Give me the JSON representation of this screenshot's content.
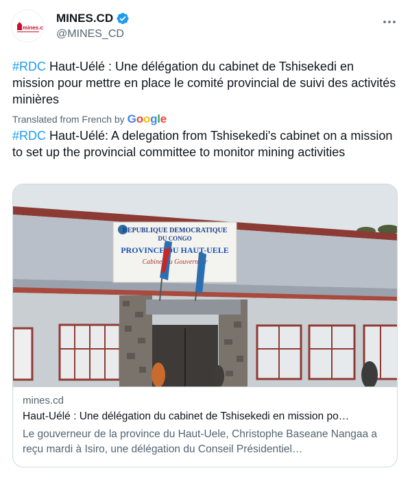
{
  "account": {
    "display_name": "MINES.CD",
    "handle": "@MINES_CD",
    "avatar_logo_text": "mines.cd",
    "verified": true
  },
  "tweet": {
    "original": {
      "hashtag": "#RDC",
      "text": " Haut-Uélé : Une délégation du cabinet de Tshisekedi en mission pour mettre en place le comité provincial de suivi des activités minières"
    },
    "translation_label": "Translated from French by",
    "translation_provider": "Google",
    "translated": {
      "hashtag": "#RDC",
      "text": " Haut-Uélé: A delegation from Tshisekedi's cabinet on a mission to set up the provincial committee to monitor mining activities"
    }
  },
  "link_card": {
    "image_sign_lines": [
      "REPUBLIQUE DEMOCRATIQUE",
      "DU CONGO",
      "PROVINCE DU HAUT-UELE",
      "Cabinet du Gouverneur"
    ],
    "domain": "mines.cd",
    "title": "Haut-Uélé : Une délégation du cabinet de Tshisekedi en mission po…",
    "description": "Le gouverneur de la province du Haut-Uele, Christophe Baseane Nangaa a reçu mardi à Isiro, une délégation du Conseil Présidentiel…"
  },
  "colors": {
    "accent": "#1d9bf0",
    "text_primary": "#0f1419",
    "text_secondary": "#536471",
    "border": "#cfd9de"
  },
  "icons": [
    "verified-badge-icon",
    "more-options-icon",
    "google-logo"
  ]
}
